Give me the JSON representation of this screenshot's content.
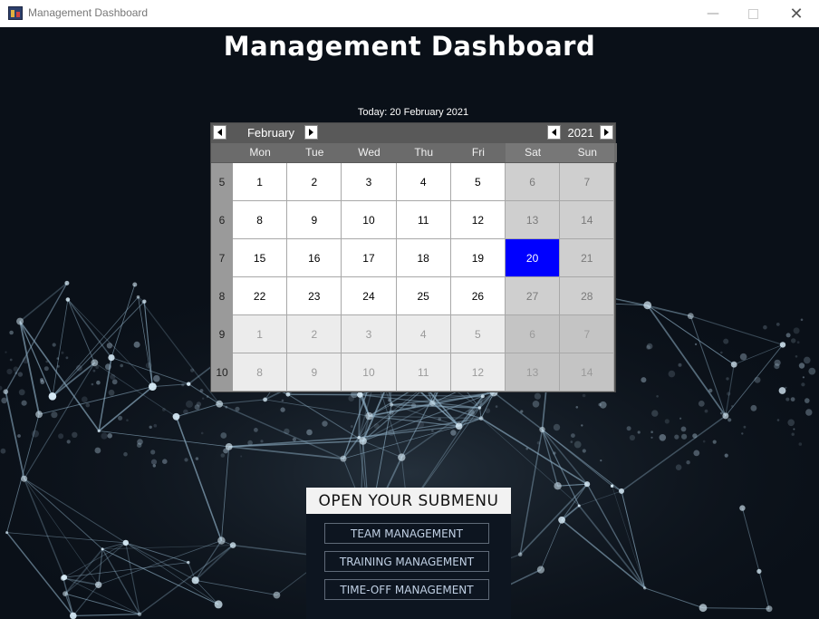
{
  "window": {
    "title": "Management Dashboard",
    "icon": "app-icon",
    "controls": {
      "minimize": "—",
      "close": "✕"
    }
  },
  "page": {
    "title": "Management Dashboard"
  },
  "calendar": {
    "today_label": "Today: 20 February 2021",
    "month": "February",
    "year": "2021",
    "weekdays": [
      "Mon",
      "Tue",
      "Wed",
      "Thu",
      "Fri",
      "Sat",
      "Sun"
    ],
    "weeks": [
      {
        "number": "5",
        "days": [
          {
            "d": "1",
            "cur": true
          },
          {
            "d": "2",
            "cur": true
          },
          {
            "d": "3",
            "cur": true
          },
          {
            "d": "4",
            "cur": true
          },
          {
            "d": "5",
            "cur": true
          },
          {
            "d": "6",
            "cur": true
          },
          {
            "d": "7",
            "cur": true
          }
        ]
      },
      {
        "number": "6",
        "days": [
          {
            "d": "8",
            "cur": true
          },
          {
            "d": "9",
            "cur": true
          },
          {
            "d": "10",
            "cur": true
          },
          {
            "d": "11",
            "cur": true
          },
          {
            "d": "12",
            "cur": true
          },
          {
            "d": "13",
            "cur": true
          },
          {
            "d": "14",
            "cur": true
          }
        ]
      },
      {
        "number": "7",
        "days": [
          {
            "d": "15",
            "cur": true
          },
          {
            "d": "16",
            "cur": true
          },
          {
            "d": "17",
            "cur": true
          },
          {
            "d": "18",
            "cur": true
          },
          {
            "d": "19",
            "cur": true
          },
          {
            "d": "20",
            "cur": true,
            "selected": true
          },
          {
            "d": "21",
            "cur": true
          }
        ]
      },
      {
        "number": "8",
        "days": [
          {
            "d": "22",
            "cur": true
          },
          {
            "d": "23",
            "cur": true
          },
          {
            "d": "24",
            "cur": true
          },
          {
            "d": "25",
            "cur": true
          },
          {
            "d": "26",
            "cur": true
          },
          {
            "d": "27",
            "cur": true
          },
          {
            "d": "28",
            "cur": true
          }
        ]
      },
      {
        "number": "9",
        "days": [
          {
            "d": "1",
            "cur": false
          },
          {
            "d": "2",
            "cur": false
          },
          {
            "d": "3",
            "cur": false
          },
          {
            "d": "4",
            "cur": false
          },
          {
            "d": "5",
            "cur": false
          },
          {
            "d": "6",
            "cur": false
          },
          {
            "d": "7",
            "cur": false
          }
        ]
      },
      {
        "number": "10",
        "days": [
          {
            "d": "8",
            "cur": false
          },
          {
            "d": "9",
            "cur": false
          },
          {
            "d": "10",
            "cur": false
          },
          {
            "d": "11",
            "cur": false
          },
          {
            "d": "12",
            "cur": false
          },
          {
            "d": "13",
            "cur": false
          },
          {
            "d": "14",
            "cur": false
          }
        ]
      }
    ],
    "colors": {
      "selected_bg": "#0000ff",
      "selected_fg": "#ffffff",
      "weekday_bg": "#ffffff",
      "weekend_bg": "#cfcfcf",
      "other_weekday_bg": "#ececec",
      "other_weekend_bg": "#c4c4c4"
    }
  },
  "submenu": {
    "title": "OPEN YOUR SUBMENU",
    "items": [
      "TEAM MANAGEMENT",
      "TRAINING MANAGEMENT",
      "TIME-OFF MANAGEMENT"
    ]
  }
}
